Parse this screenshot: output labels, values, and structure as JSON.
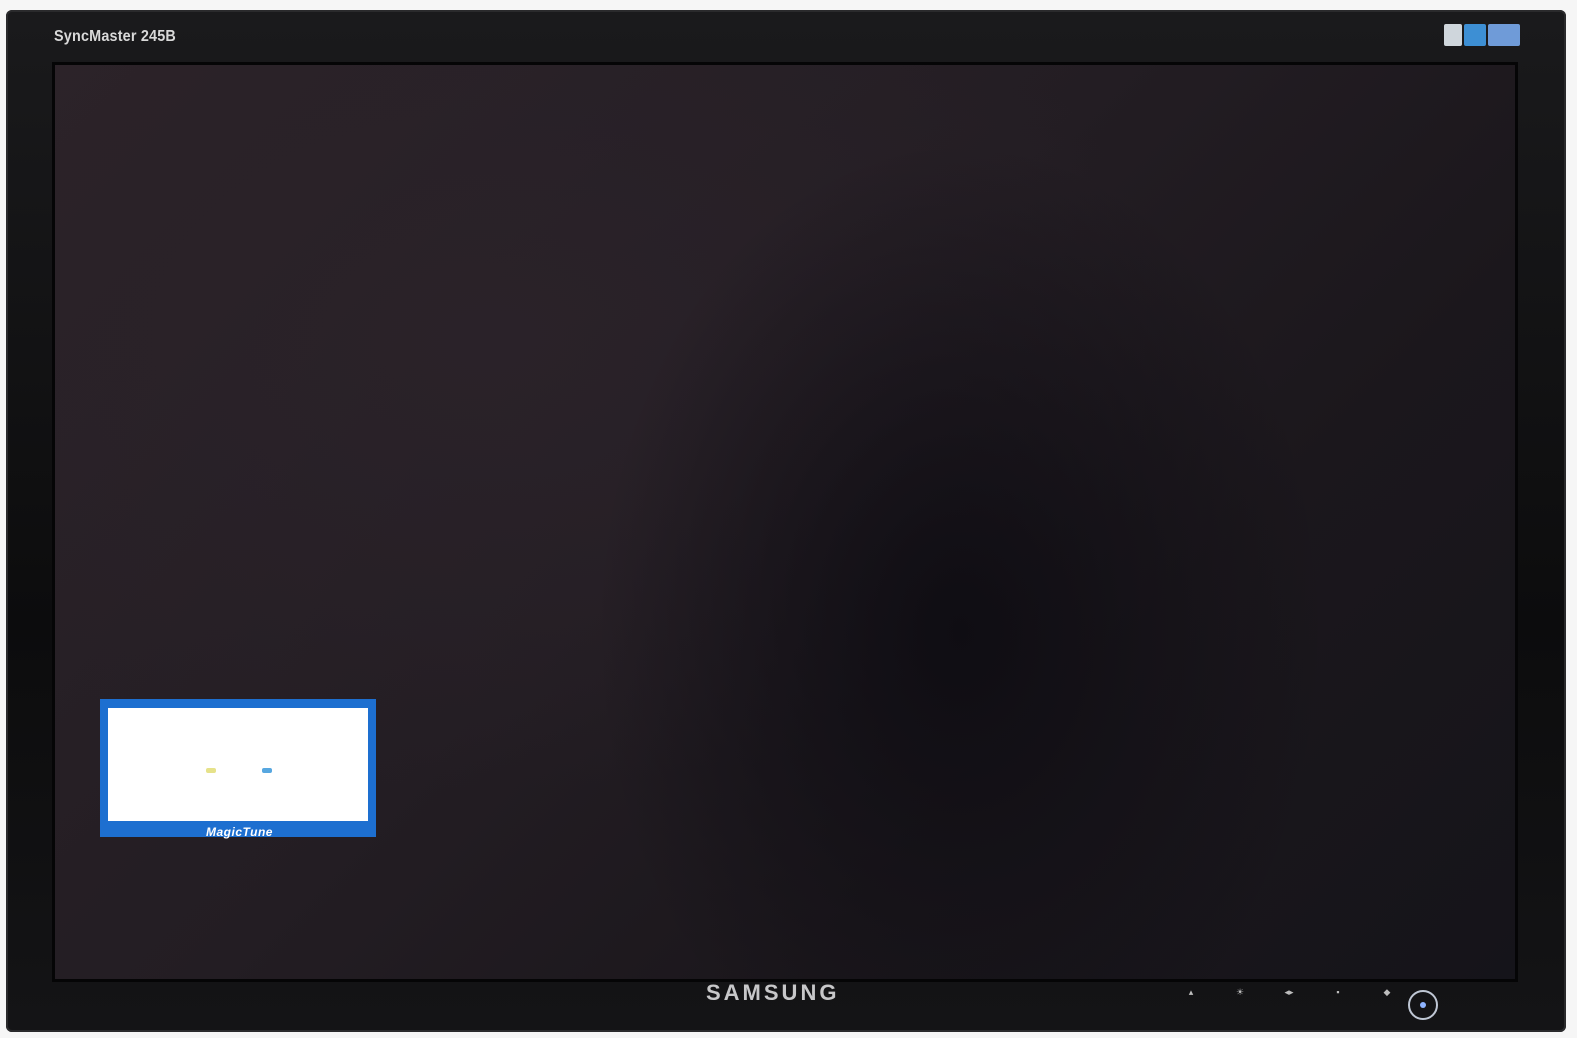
{
  "monitor": {
    "model": "SyncMaster 245B",
    "brand": "SAMSUNG",
    "bezel_color": "#111113",
    "screen_color": "#251f25"
  },
  "osd": {
    "frame_color": "#1d6fd0",
    "caption": "MagicTune"
  },
  "badges": [
    {
      "icon": "certification-badge-icon",
      "color": "#cfd6dc"
    },
    {
      "icon": "blue-label-badge-icon",
      "color": "#3d8fd4"
    },
    {
      "icon": "energy-badge-icon",
      "color": "#6f9bd8"
    }
  ],
  "controls": [
    {
      "icon": "menu-button-icon"
    },
    {
      "icon": "brightness-button-icon"
    },
    {
      "icon": "adjust-button-icon"
    },
    {
      "icon": "source-button-icon"
    },
    {
      "icon": "auto-button-icon"
    },
    {
      "icon": "power-button-icon"
    }
  ]
}
